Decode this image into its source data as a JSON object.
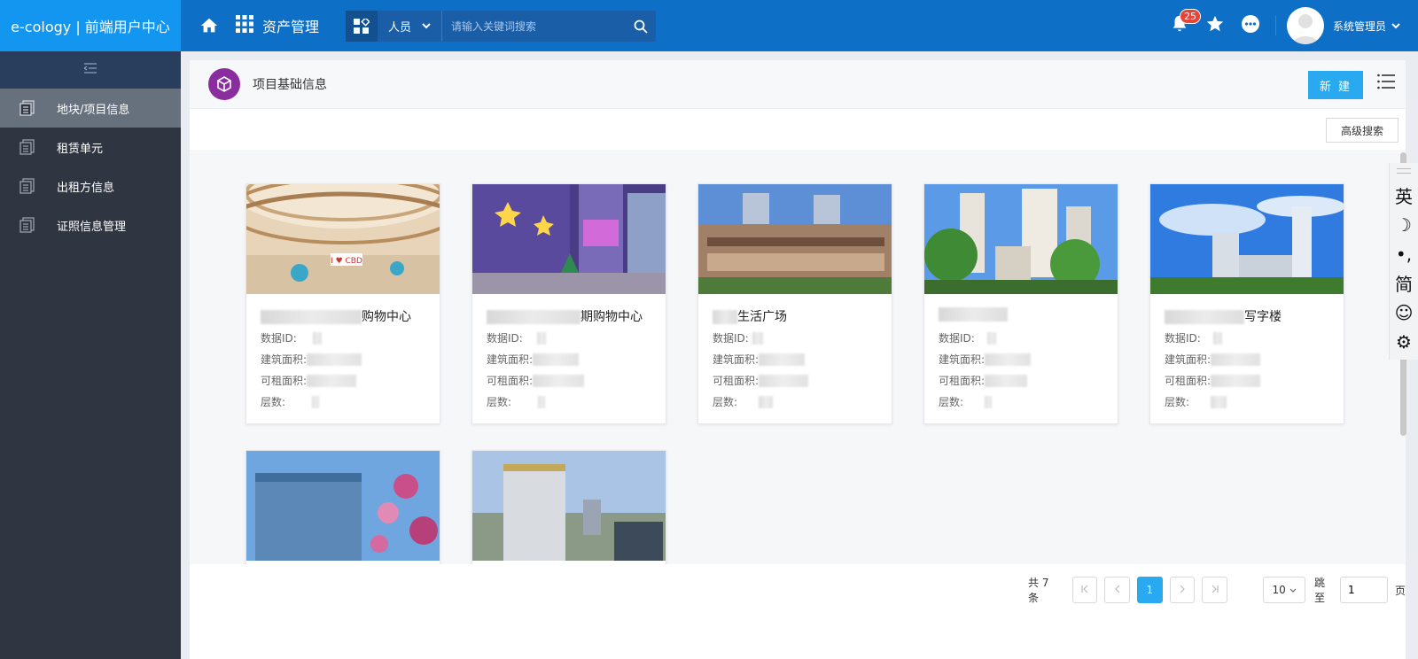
{
  "app": {
    "brand": "e-cology | 前端用户中心",
    "module": "资产管理",
    "search": {
      "scope": "人员",
      "placeholder": "请输入关键词搜索"
    },
    "notifications_count": "25",
    "user_name": "系统管理员"
  },
  "sidebar": {
    "items": [
      {
        "label": "地块/项目信息",
        "active": true
      },
      {
        "label": "租赁单元",
        "active": false
      },
      {
        "label": "出租方信息",
        "active": false
      },
      {
        "label": "证照信息管理",
        "active": false
      }
    ]
  },
  "page": {
    "title": "项目基础信息",
    "new_button": "新 建",
    "advanced_search": "高级搜索"
  },
  "card_fields": {
    "id": "数据ID:",
    "building_area": "建筑面积:",
    "rentable_area": "可租面积:",
    "floors": "层数:"
  },
  "cards": [
    {
      "title": "购物中心",
      "image": "mall-atrium"
    },
    {
      "title": "期购物中心",
      "image": "mall-night"
    },
    {
      "title": "生活广场",
      "image": "shopping-plaza"
    },
    {
      "title": "",
      "image": "residential-towers"
    },
    {
      "title": "写字楼",
      "image": "office-tower-sky"
    },
    {
      "title": "",
      "image": "office-blossom"
    },
    {
      "title": "",
      "image": "office-city"
    }
  ],
  "pagination": {
    "total": "共 7 条",
    "current_page": "1",
    "page_size": "10",
    "jump_label": "跳至",
    "jump_value": "1",
    "page_unit": "页"
  },
  "ime": [
    "英",
    "☽",
    "•,",
    "简",
    "☺",
    "⚙"
  ],
  "colors": {
    "topbar": "#0d6fc6",
    "brand": "#1296f0",
    "sidebar": "#2f3541",
    "primary_button": "#29aaf0",
    "badge": "#e84335"
  }
}
